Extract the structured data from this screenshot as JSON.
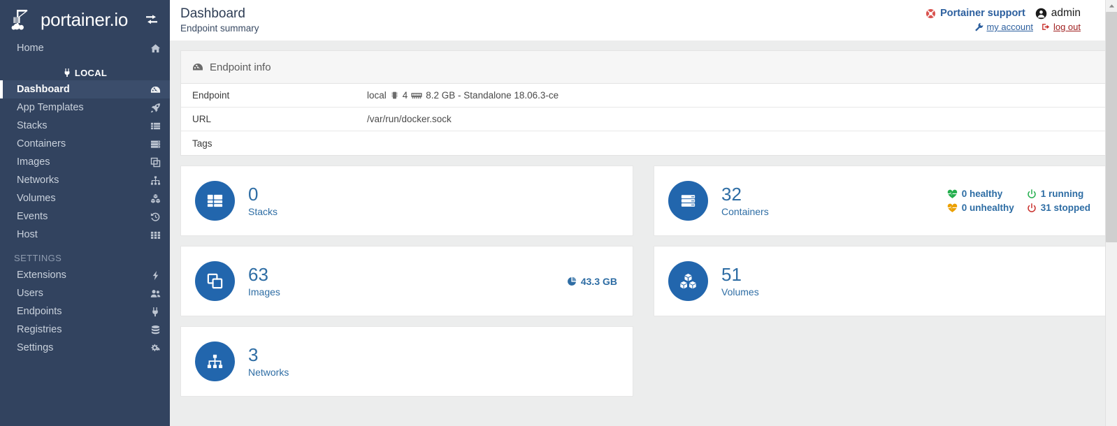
{
  "brand": {
    "name": "portainer.io",
    "logo_icon": "portainer-crane-logo",
    "toggle_icon": "exchange-arrows-icon"
  },
  "sidebar": {
    "home": {
      "label": "Home",
      "icon": "home-icon"
    },
    "local_section": {
      "label": "LOCAL",
      "icon": "plug-icon"
    },
    "items": [
      {
        "label": "Dashboard",
        "icon": "tachometer-icon",
        "active": true
      },
      {
        "label": "App Templates",
        "icon": "rocket-icon",
        "active": false
      },
      {
        "label": "Stacks",
        "icon": "list-icon",
        "active": false
      },
      {
        "label": "Containers",
        "icon": "server-icon",
        "active": false
      },
      {
        "label": "Images",
        "icon": "clone-icon",
        "active": false
      },
      {
        "label": "Networks",
        "icon": "sitemap-icon",
        "active": false
      },
      {
        "label": "Volumes",
        "icon": "cubes-icon",
        "active": false
      },
      {
        "label": "Events",
        "icon": "history-icon",
        "active": false
      },
      {
        "label": "Host",
        "icon": "th-icon",
        "active": false
      }
    ],
    "settings_section": {
      "label": "SETTINGS"
    },
    "settings_items": [
      {
        "label": "Extensions",
        "icon": "bolt-icon"
      },
      {
        "label": "Users",
        "icon": "users-icon"
      },
      {
        "label": "Endpoints",
        "icon": "plug-icon"
      },
      {
        "label": "Registries",
        "icon": "database-icon"
      },
      {
        "label": "Settings",
        "icon": "cogs-icon"
      }
    ]
  },
  "header": {
    "title": "Dashboard",
    "subtitle": "Endpoint summary",
    "support_label": "Portainer support",
    "support_icon": "life-ring-icon",
    "user_name": "admin",
    "user_icon": "user-circle-icon",
    "my_account_label": "my account",
    "my_account_icon": "wrench-icon",
    "log_out_label": "log out",
    "log_out_icon": "sign-out-icon"
  },
  "endpoint_panel": {
    "title": "Endpoint info",
    "icon": "tachometer-icon",
    "rows": [
      {
        "key": "Endpoint",
        "value": ""
      },
      {
        "key": "URL",
        "value": "/var/run/docker.sock"
      },
      {
        "key": "Tags",
        "value": ""
      }
    ],
    "endpoint_name": "local",
    "cpu_icon": "microchip-icon",
    "cpu_count": "4",
    "memory_icon": "memory-icon",
    "memory_and_version": "8.2 GB - Standalone 18.06.3-ce"
  },
  "cards": {
    "stacks": {
      "count": "0",
      "label": "Stacks",
      "icon": "list-alt-icon"
    },
    "images": {
      "count": "63",
      "label": "Images",
      "icon": "clone-icon",
      "size": "43.3 GB",
      "size_icon": "pie-chart-icon"
    },
    "networks": {
      "count": "3",
      "label": "Networks",
      "icon": "sitemap-icon"
    },
    "containers": {
      "count": "32",
      "label": "Containers",
      "icon": "server-icon",
      "statuses": [
        {
          "text": "0 healthy",
          "icon": "heartbeat-icon",
          "color": "#23ae4d"
        },
        {
          "text": "1 running",
          "icon": "power-icon",
          "color": "#23ae4d"
        },
        {
          "text": "0 unhealthy",
          "icon": "heartbeat-icon",
          "color": "#eba000"
        },
        {
          "text": "31 stopped",
          "icon": "power-icon",
          "color": "#c9302c"
        }
      ]
    },
    "volumes": {
      "count": "51",
      "label": "Volumes",
      "icon": "cubes-icon"
    }
  },
  "colors": {
    "sidebar_bg": "#32435f",
    "accent_blue": "#2266ad",
    "text_blue": "#2e6da4",
    "page_bg": "#eceded",
    "support_red": "#d9534f",
    "logout_red": "#a02020"
  },
  "scrollbar": {
    "up_arrow_icon": "caret-up-icon"
  }
}
